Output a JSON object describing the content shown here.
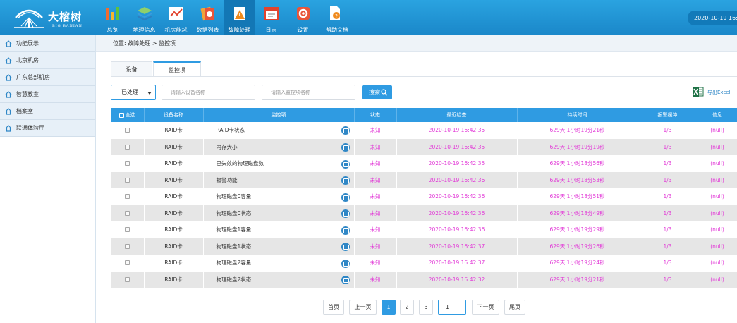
{
  "app": {
    "brand": "大榕树",
    "brand_en": "BIG BANIAN",
    "datetime": "2020-10-19 16:42:39"
  },
  "nav": [
    {
      "label": "总览",
      "icon": "overview-chart-icon"
    },
    {
      "label": "地理信息",
      "icon": "map-layers-icon"
    },
    {
      "label": "机房能耗",
      "icon": "energy-chart-icon"
    },
    {
      "label": "数据列表",
      "icon": "data-list-icon"
    },
    {
      "label": "故障处理",
      "icon": "fault-warning-icon"
    },
    {
      "label": "日志",
      "icon": "log-calendar-icon"
    },
    {
      "label": "设置",
      "icon": "settings-gear-icon"
    },
    {
      "label": "帮助文档",
      "icon": "help-document-icon"
    }
  ],
  "sidebar": {
    "items": [
      {
        "label": "功能展示"
      },
      {
        "label": "北京机房"
      },
      {
        "label": "广东总部机房"
      },
      {
        "label": "智慧教室"
      },
      {
        "label": "档案室"
      },
      {
        "label": "联通体验厅"
      }
    ]
  },
  "breadcrumb": "位置: 故障处理 > 监控项",
  "tabs": [
    {
      "label": "设备"
    },
    {
      "label": "监控项"
    }
  ],
  "filters": {
    "status_selected": "已处理",
    "device_placeholder": "请输入设备名称",
    "item_placeholder": "请输入监控项名称",
    "search_label": "搜索",
    "export_label": "导出Excel"
  },
  "table": {
    "headers": [
      "全选",
      "设备名称",
      "监控项",
      "状态",
      "最近检查",
      "持续时间",
      "报警缓冲",
      "信息"
    ],
    "rows": [
      {
        "device": "RAID卡",
        "item": "RAID卡状态",
        "status": "未知",
        "last_check": "2020-10-19 16:42:35",
        "duration": "629天 1小时19分21秒",
        "buffer": "1/3",
        "info": "(null)"
      },
      {
        "device": "RAID卡",
        "item": "内存大小",
        "status": "未知",
        "last_check": "2020-10-19 16:42:35",
        "duration": "629天 1小时19分19秒",
        "buffer": "1/3",
        "info": "(null)"
      },
      {
        "device": "RAID卡",
        "item": "已失效的物理磁盘数",
        "status": "未知",
        "last_check": "2020-10-19 16:42:35",
        "duration": "629天 1小时18分56秒",
        "buffer": "1/3",
        "info": "(null)"
      },
      {
        "device": "RAID卡",
        "item": "报警功能",
        "status": "未知",
        "last_check": "2020-10-19 16:42:36",
        "duration": "629天 1小时18分53秒",
        "buffer": "1/3",
        "info": "(null)"
      },
      {
        "device": "RAID卡",
        "item": "物理磁盘0容量",
        "status": "未知",
        "last_check": "2020-10-19 16:42:36",
        "duration": "629天 1小时18分51秒",
        "buffer": "1/3",
        "info": "(null)"
      },
      {
        "device": "RAID卡",
        "item": "物理磁盘0状态",
        "status": "未知",
        "last_check": "2020-10-19 16:42:36",
        "duration": "629天 1小时18分49秒",
        "buffer": "1/3",
        "info": "(null)"
      },
      {
        "device": "RAID卡",
        "item": "物理磁盘1容量",
        "status": "未知",
        "last_check": "2020-10-19 16:42:36",
        "duration": "629天 1小时19分29秒",
        "buffer": "1/3",
        "info": "(null)"
      },
      {
        "device": "RAID卡",
        "item": "物理磁盘1状态",
        "status": "未知",
        "last_check": "2020-10-19 16:42:37",
        "duration": "629天 1小时19分26秒",
        "buffer": "1/3",
        "info": "(null)"
      },
      {
        "device": "RAID卡",
        "item": "物理磁盘2容量",
        "status": "未知",
        "last_check": "2020-10-19 16:42:37",
        "duration": "629天 1小时19分24秒",
        "buffer": "1/3",
        "info": "(null)"
      },
      {
        "device": "RAID卡",
        "item": "物理磁盘2状态",
        "status": "未知",
        "last_check": "2020-10-19 16:42:32",
        "duration": "629天 1小时19分21秒",
        "buffer": "1/3",
        "info": "(null)"
      }
    ]
  },
  "pagination": {
    "first": "首页",
    "prev": "上一页",
    "pages": [
      "1",
      "2",
      "3"
    ],
    "current": "1",
    "jump_value": "1",
    "next": "下一页",
    "last": "尾页"
  },
  "colors": {
    "header_blue": "#1a87c9",
    "accent": "#2f9be2",
    "status_pink": "#e23bd7"
  }
}
